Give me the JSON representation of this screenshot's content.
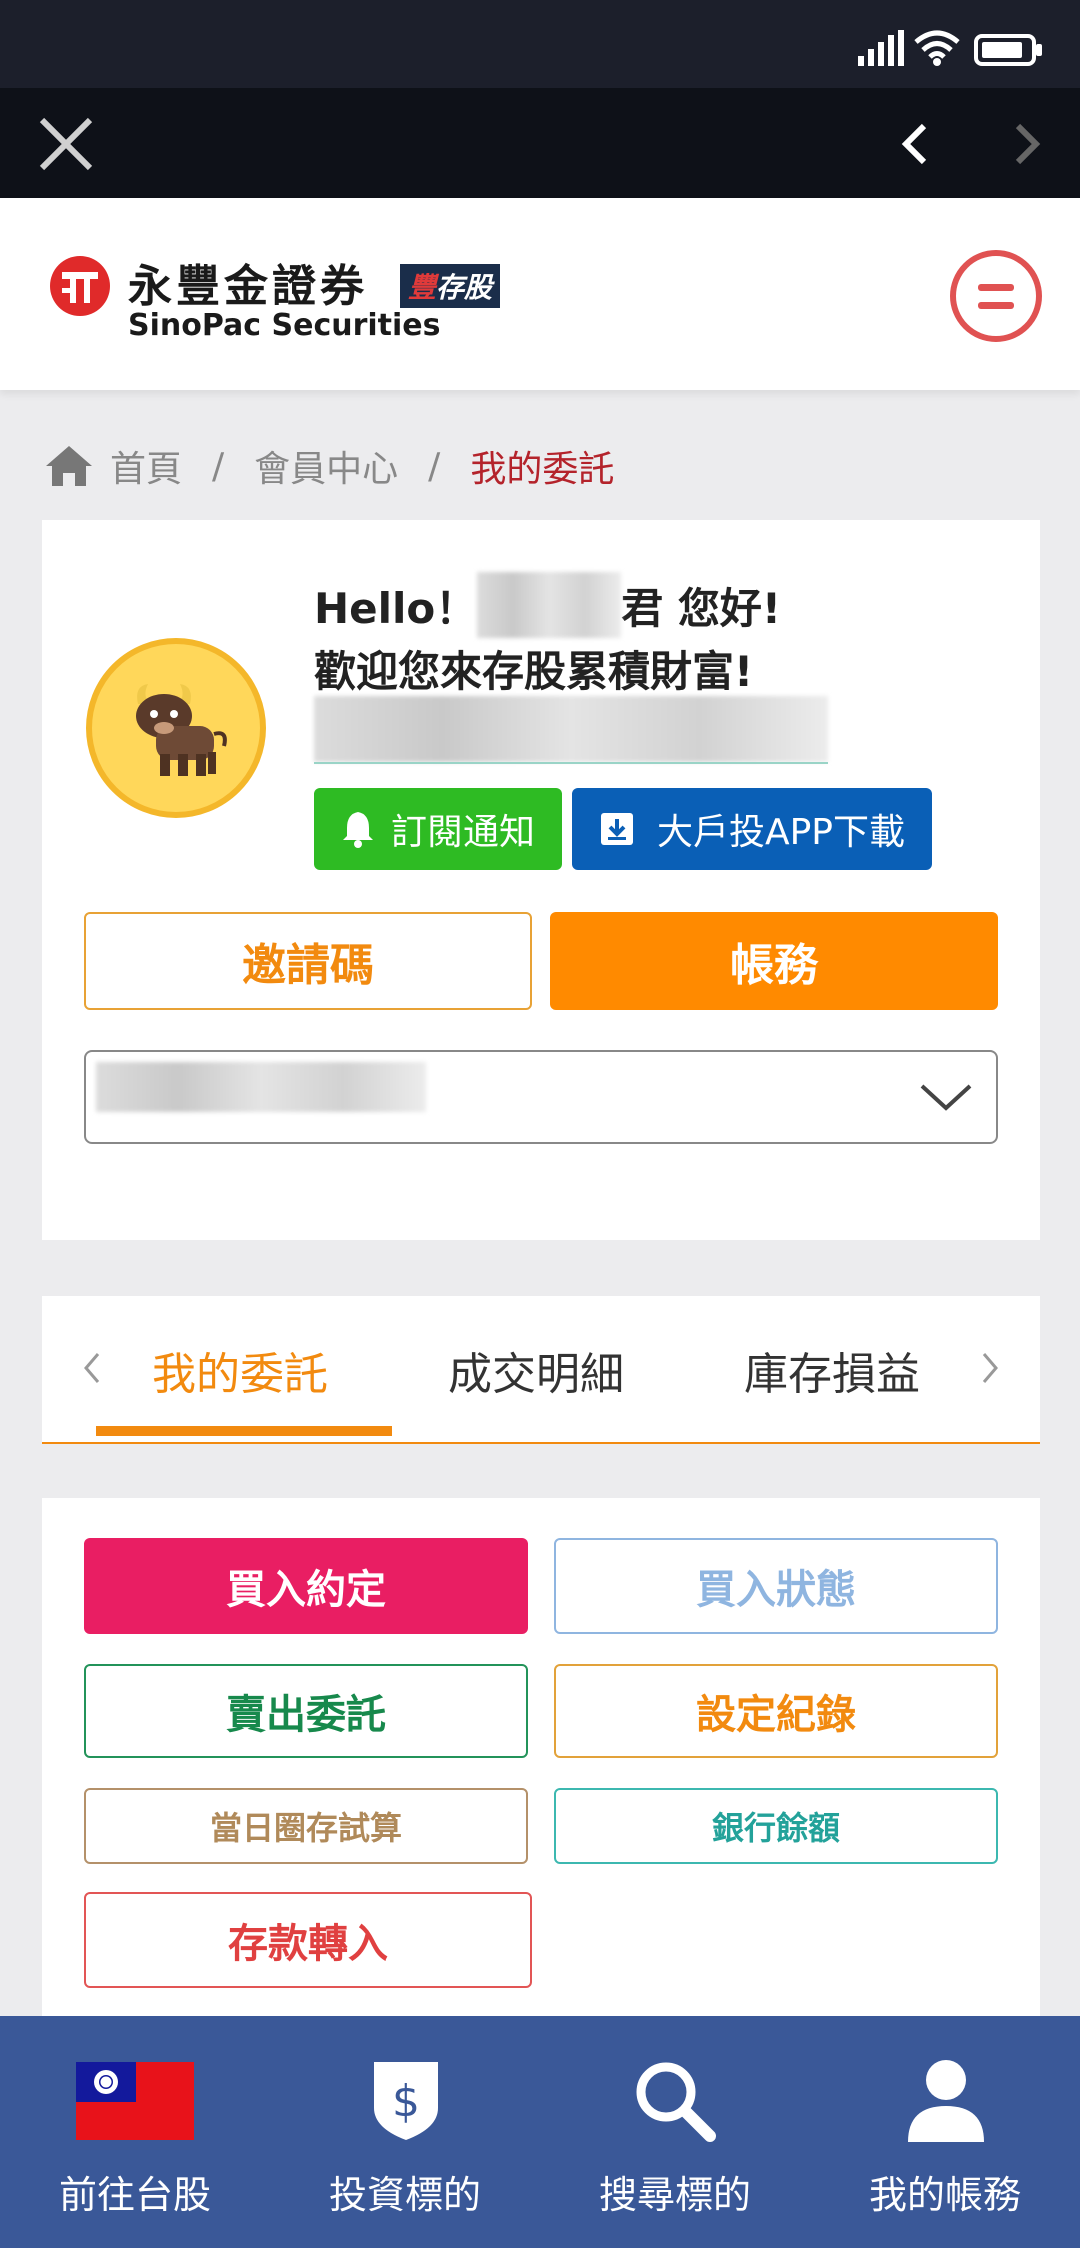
{
  "breadcrumb": {
    "home": "首頁",
    "member": "會員中心",
    "current": "我的委託",
    "separator": "/"
  },
  "brand": {
    "name_cn": "永豐金證券",
    "name_en": "SinoPac Securities",
    "tag": "豐存股",
    "tag_first": "豐",
    "tag_rest": "存股"
  },
  "profile": {
    "hello_prefix": "Hello！",
    "hello_suffix": "君 您好!",
    "welcome": "歡迎您來存股累積財富!",
    "subscribe_label": "訂閱通知",
    "download_label": "大戶投APP下載",
    "invite_label": "邀請碼",
    "account_label": "帳務"
  },
  "tabs": [
    "我的委託",
    "成交明細",
    "庫存損益"
  ],
  "actions": {
    "buy_agreement": "買入約定",
    "buy_status": "買入狀態",
    "sell_order": "賣出委託",
    "settings_log": "設定紀錄",
    "daily_trial": "當日圈存試算",
    "bank_balance": "銀行餘額",
    "deposit_in": "存款轉入"
  },
  "bottom_nav": [
    "前往台股",
    "投資標的",
    "搜尋標的",
    "我的帳務"
  ],
  "colors": {
    "brand_red": "#b4232b",
    "orange": "#f28a0f",
    "pink": "#e91e63",
    "green": "#2ebb23",
    "blue": "#0a5fb6",
    "nav_blue": "#3a5898"
  }
}
